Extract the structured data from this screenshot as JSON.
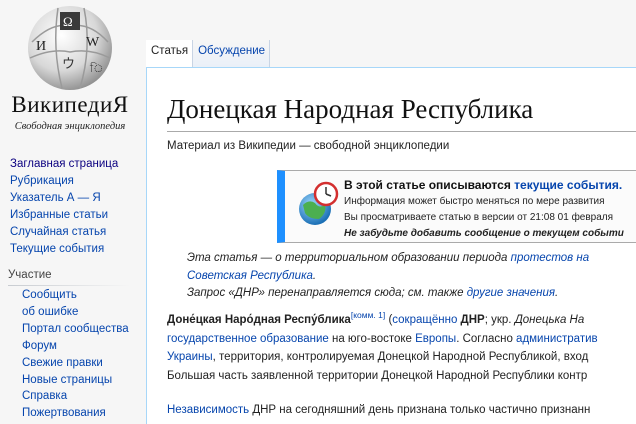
{
  "logo": {
    "wordmark": "ВикипедиЯ",
    "tagline": "Свободная энциклопедия"
  },
  "sidebar": {
    "main_links": [
      "Заглавная страница",
      "Рубрикация",
      "Указатель А — Я",
      "Избранные статьи",
      "Случайная статья",
      "Текущие события"
    ],
    "portal_heading": "Участие",
    "portal_links": [
      "Сообщить",
      "об ошибке",
      "Портал сообщества",
      "Форум",
      "Свежие правки",
      "Новые страницы",
      "Справка",
      "Пожертвования"
    ]
  },
  "tabs": [
    "Статья",
    "Обсуждение"
  ],
  "article": {
    "title": "Донецкая Народная Республика",
    "site_sub": "Материал из Википедии — свободной энциклопедии",
    "ambox": {
      "title_prefix": "В этой статье описываются ",
      "title_link": "текущие события.",
      "line1": "Информация может быстро меняться по мере развития",
      "line2": "Вы просматриваете статью в версии от 21:08 01 февраля",
      "line3": "Не забудьте добавить сообщение о текущем событи"
    },
    "hatnote": {
      "l1_text": "Эта статья — о территориальном образовании периода ",
      "l1_link": "протестов на",
      "l2_link": "Советская Республика",
      "l2_end": ".",
      "l3_text": "Запрос «ДНР» перенаправляется сюда; см. также ",
      "l3_link": "другие значения",
      "l3_end": "."
    },
    "p1": {
      "lead_bold": "Доне́цкая Наро́дная Респу́блика",
      "sup": "[комм. 1]",
      "open": " (",
      "abbr_link": "сокращённо",
      "abbr_bold": " ДНР",
      "ukr_text": "; укр. ",
      "ukr_italic": "Донецька На",
      "l2_link": "государственное образование",
      "l2_text": " на юго-востоке ",
      "l2_link2": "Европы",
      "l2_text2": ". Согласно ",
      "l2_link3": "административ",
      "l3_link": "Украины",
      "l3_text": ", территория, контролируемая Донецкой Народной Республикой, вход",
      "l4_text": "Большая часть заявленной территории Донецкой Народной Республики контр"
    },
    "p2": {
      "link": "Независимость",
      "text": " ДНР на сегодняшний день признана только частично признанн"
    }
  }
}
